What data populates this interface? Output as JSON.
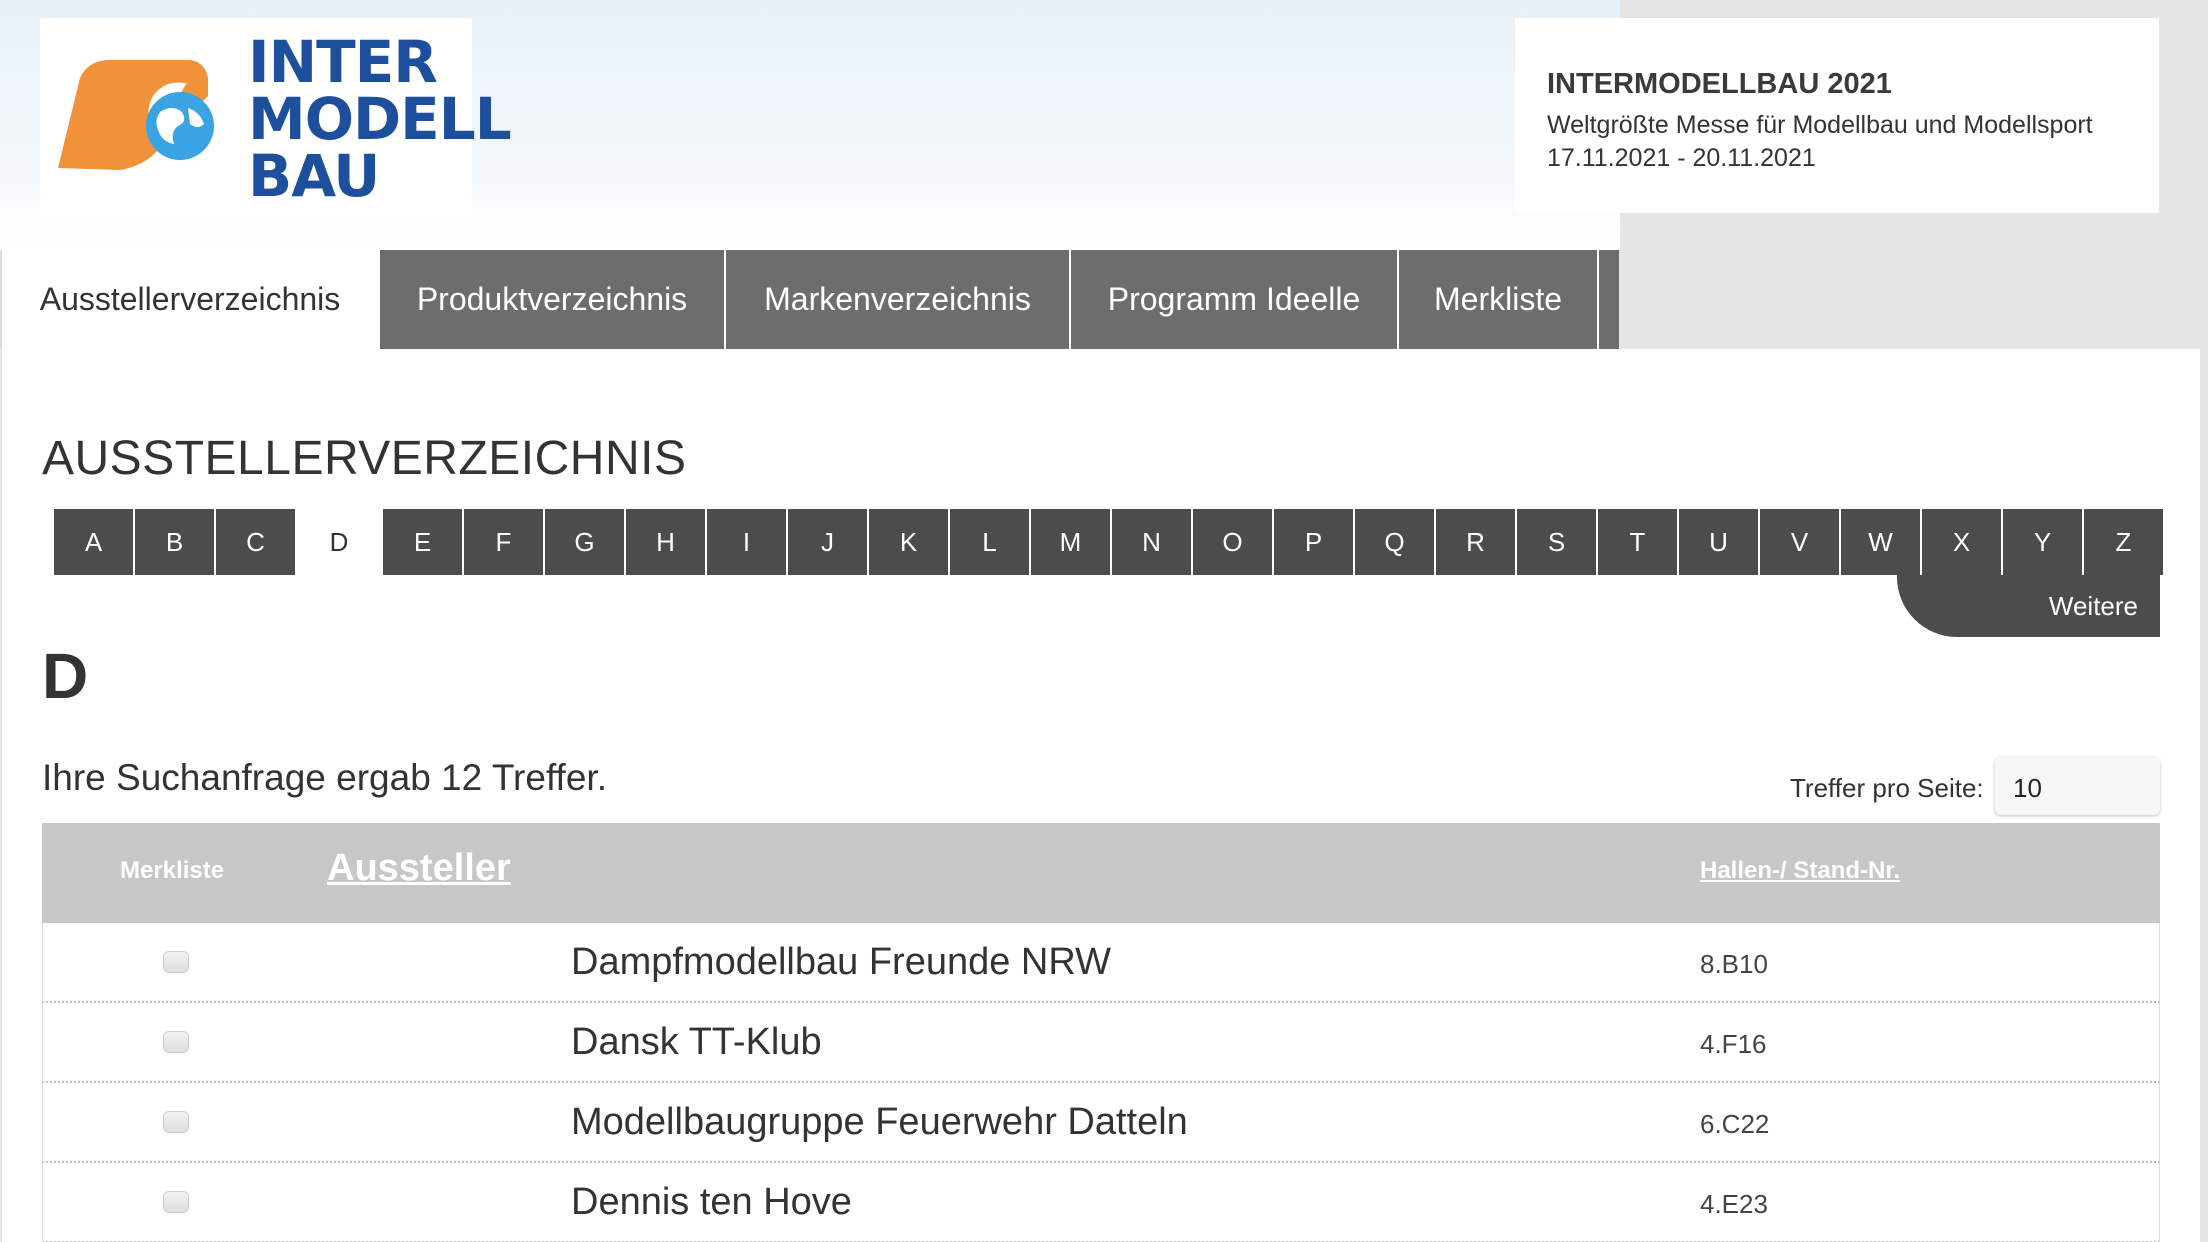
{
  "brand": {
    "logo_lines": [
      "INTER",
      "MODELL",
      "BAU"
    ],
    "colors": {
      "orange": "#f0923a",
      "blue": "#1d4f9c",
      "globe": "#3aa3e3"
    }
  },
  "event": {
    "title": "INTERMODELLBAU 2021",
    "subtitle": "Weltgrößte Messe für Modellbau und Modellsport",
    "dates": "17.11.2021 - 20.11.2021"
  },
  "nav": {
    "tabs": [
      {
        "label": "Ausstellerverzeichnis",
        "active": true
      },
      {
        "label": "Produktverzeichnis",
        "active": false
      },
      {
        "label": "Markenverzeichnis",
        "active": false
      },
      {
        "label": "Programm Ideelle",
        "active": false
      },
      {
        "label": "Merkliste",
        "active": false
      }
    ]
  },
  "main": {
    "heading": "AUSSTELLERVERZEICHNIS",
    "alphabet": [
      "A",
      "B",
      "C",
      "D",
      "E",
      "F",
      "G",
      "H",
      "I",
      "J",
      "K",
      "L",
      "M",
      "N",
      "O",
      "P",
      "Q",
      "R",
      "S",
      "T",
      "U",
      "V",
      "W",
      "X",
      "Y",
      "Z"
    ],
    "active_letter": "D",
    "more_label": "Weitere",
    "letter_heading": "D",
    "result_text": "Ihre Suchanfrage ergab 12 Treffer.",
    "per_page_label": "Treffer pro Seite:",
    "per_page_value": "10"
  },
  "table": {
    "headers": {
      "merkliste": "Merkliste",
      "aussteller": "Aussteller",
      "halle": "Hallen-/ Stand-Nr."
    },
    "rows": [
      {
        "name": "Dampfmodellbau Freunde NRW",
        "stand": "8.B10"
      },
      {
        "name": "Dansk TT-Klub",
        "stand": "4.F16"
      },
      {
        "name": "Modellbaugruppe Feuerwehr Datteln",
        "stand": "6.C22"
      },
      {
        "name": "Dennis ten Hove",
        "stand": "4.E23"
      }
    ]
  }
}
